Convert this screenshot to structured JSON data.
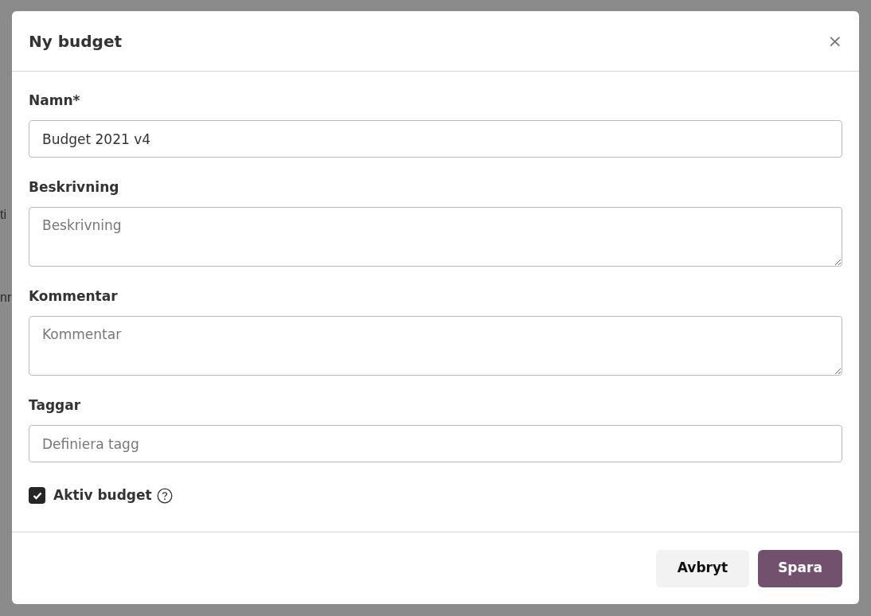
{
  "background": {
    "texts": [
      "ti",
      "nr"
    ]
  },
  "dialog": {
    "title": "Ny budget",
    "close": "×",
    "fields": [
      {
        "kind": "input",
        "label": "Namn*",
        "value": "Budget 2021 v4"
      },
      {
        "kind": "textarea",
        "label": "Beskrivning",
        "placeholder": "Beskrivning"
      },
      {
        "kind": "textarea",
        "label": "Kommentar",
        "placeholder": "Kommentar"
      },
      {
        "kind": "input",
        "label": "Taggar",
        "placeholder": "Definiera tagg"
      }
    ],
    "checkbox": {
      "label": "Aktiv budget",
      "checked": true
    },
    "buttons": [
      {
        "kind": "secondary",
        "label": "Avbryt"
      },
      {
        "kind": "primary",
        "label": "Spara"
      }
    ]
  }
}
